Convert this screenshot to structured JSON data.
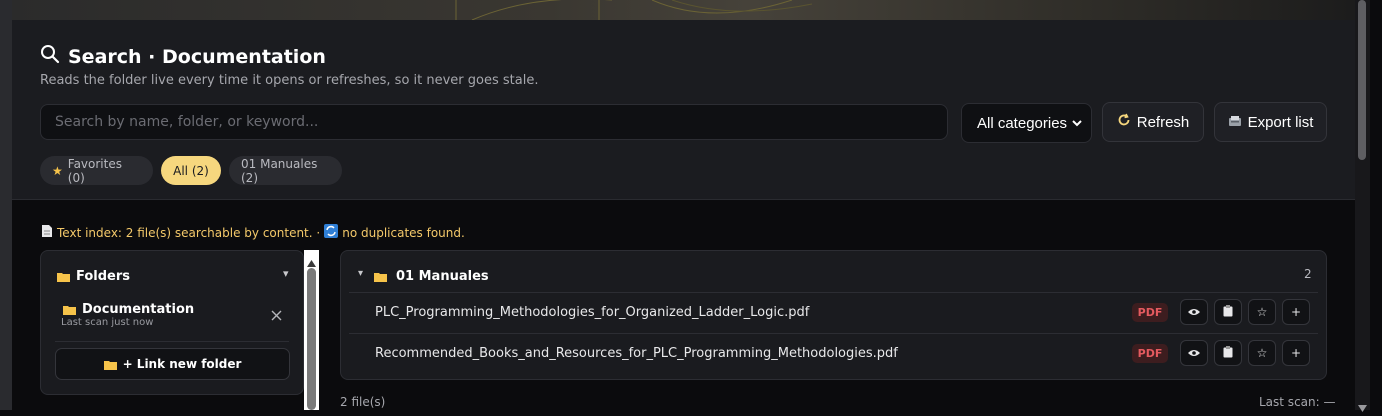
{
  "header": {
    "title": "Search · Documentation",
    "subtitle": "Reads the folder live every time it opens or refreshes, so it never goes stale."
  },
  "search": {
    "placeholder": "Search by name, folder, or keyword..."
  },
  "category_select": {
    "selected": "All categories"
  },
  "buttons": {
    "refresh": "Refresh",
    "export": "Export list"
  },
  "chips": [
    {
      "label": "Favorites (0)",
      "active": false
    },
    {
      "label": "All (2)",
      "active": true
    },
    {
      "label": "01 Manuales (2)",
      "active": false
    }
  ],
  "info": {
    "text_index": "Text index: 2 file(s) searchable by content. ·",
    "duplicates": "no duplicates found."
  },
  "folders_panel": {
    "title": "Folders",
    "folder_name": "Documentation",
    "last_scan": "Last scan just now",
    "link_button": "+ Link new folder"
  },
  "results": {
    "group_name": "01 Manuales",
    "count": "2",
    "files": [
      {
        "name": "PLC_Programming_Methodologies_for_Organized_Ladder_Logic.pdf",
        "type": "PDF"
      },
      {
        "name": "Recommended_Books_and_Resources_for_PLC_Programming_Methodologies.pdf",
        "type": "PDF"
      }
    ]
  },
  "footer": {
    "file_count": "2 file(s)",
    "last_scan": "Last scan: —"
  },
  "colors": {
    "accent": "#f6d77e",
    "pdf_badge": "#e45a5f",
    "info_text": "#f4c96a"
  }
}
